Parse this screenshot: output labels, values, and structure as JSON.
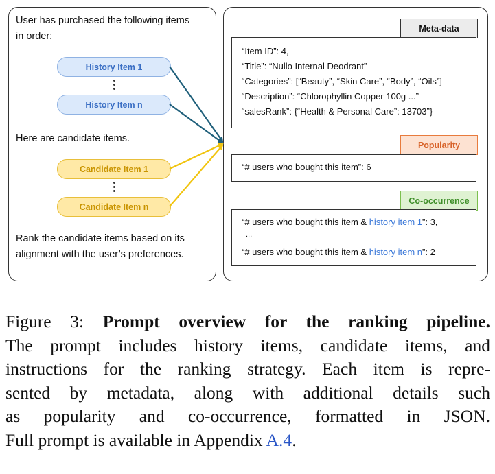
{
  "left": {
    "intro_line1": "User has purchased the following items",
    "intro_line2": "in order:",
    "history_first": "History Item 1",
    "history_last": "History Item n",
    "candidates_intro": "Here are candidate items.",
    "candidate_first": "Candidate Item 1",
    "candidate_last": "Candidate Item n",
    "rank_line1": "Rank the candidate items based on its",
    "rank_line2": "alignment with the user’s preferences."
  },
  "right": {
    "meta_label": "Meta-data",
    "meta_lines": [
      "“Item ID”: 4,",
      "“Title”: “Nullo Internal Deodrant”",
      "“Categories”: [“Beauty”, “Skin Care”, “Body”, “Oils”]",
      "“Description”: “Chlorophyllin Copper 100g ...”",
      "“salesRank”: {“Health & Personal Care”: 13703”}"
    ],
    "popularity_label": "Popularity",
    "popularity_line": "“# users who bought this item”: 6",
    "cooccurrence_label": "Co-occurrence",
    "co_line1_pre": "“# users who bought this item & ",
    "co_line1_link": "history item 1",
    "co_line1_post": "”: 3,",
    "co_ellipsis": "...",
    "co_line2_pre": "“# users who bought this item & ",
    "co_line2_link": "history item n",
    "co_line2_post": "”: 2"
  },
  "colors": {
    "history_arrow": "#1f5f7a",
    "candidate_arrow": "#f1c40f",
    "history_link": "#3b78d8"
  },
  "caption": {
    "label": "Figure 3:",
    "bold": "Prompt overview for the ranking pipeline.",
    "line2": "The prompt includes history items, candidate items, and",
    "line3": "instructions for the ranking strategy. Each item is repre-",
    "line4": "sented by metadata, along with additional details such",
    "line5": "as popularity and co-occurrence, formatted in JSON.",
    "line6_pre": "Full prompt is available in Appendix ",
    "line6_link": "A.4",
    "line6_post": "."
  }
}
